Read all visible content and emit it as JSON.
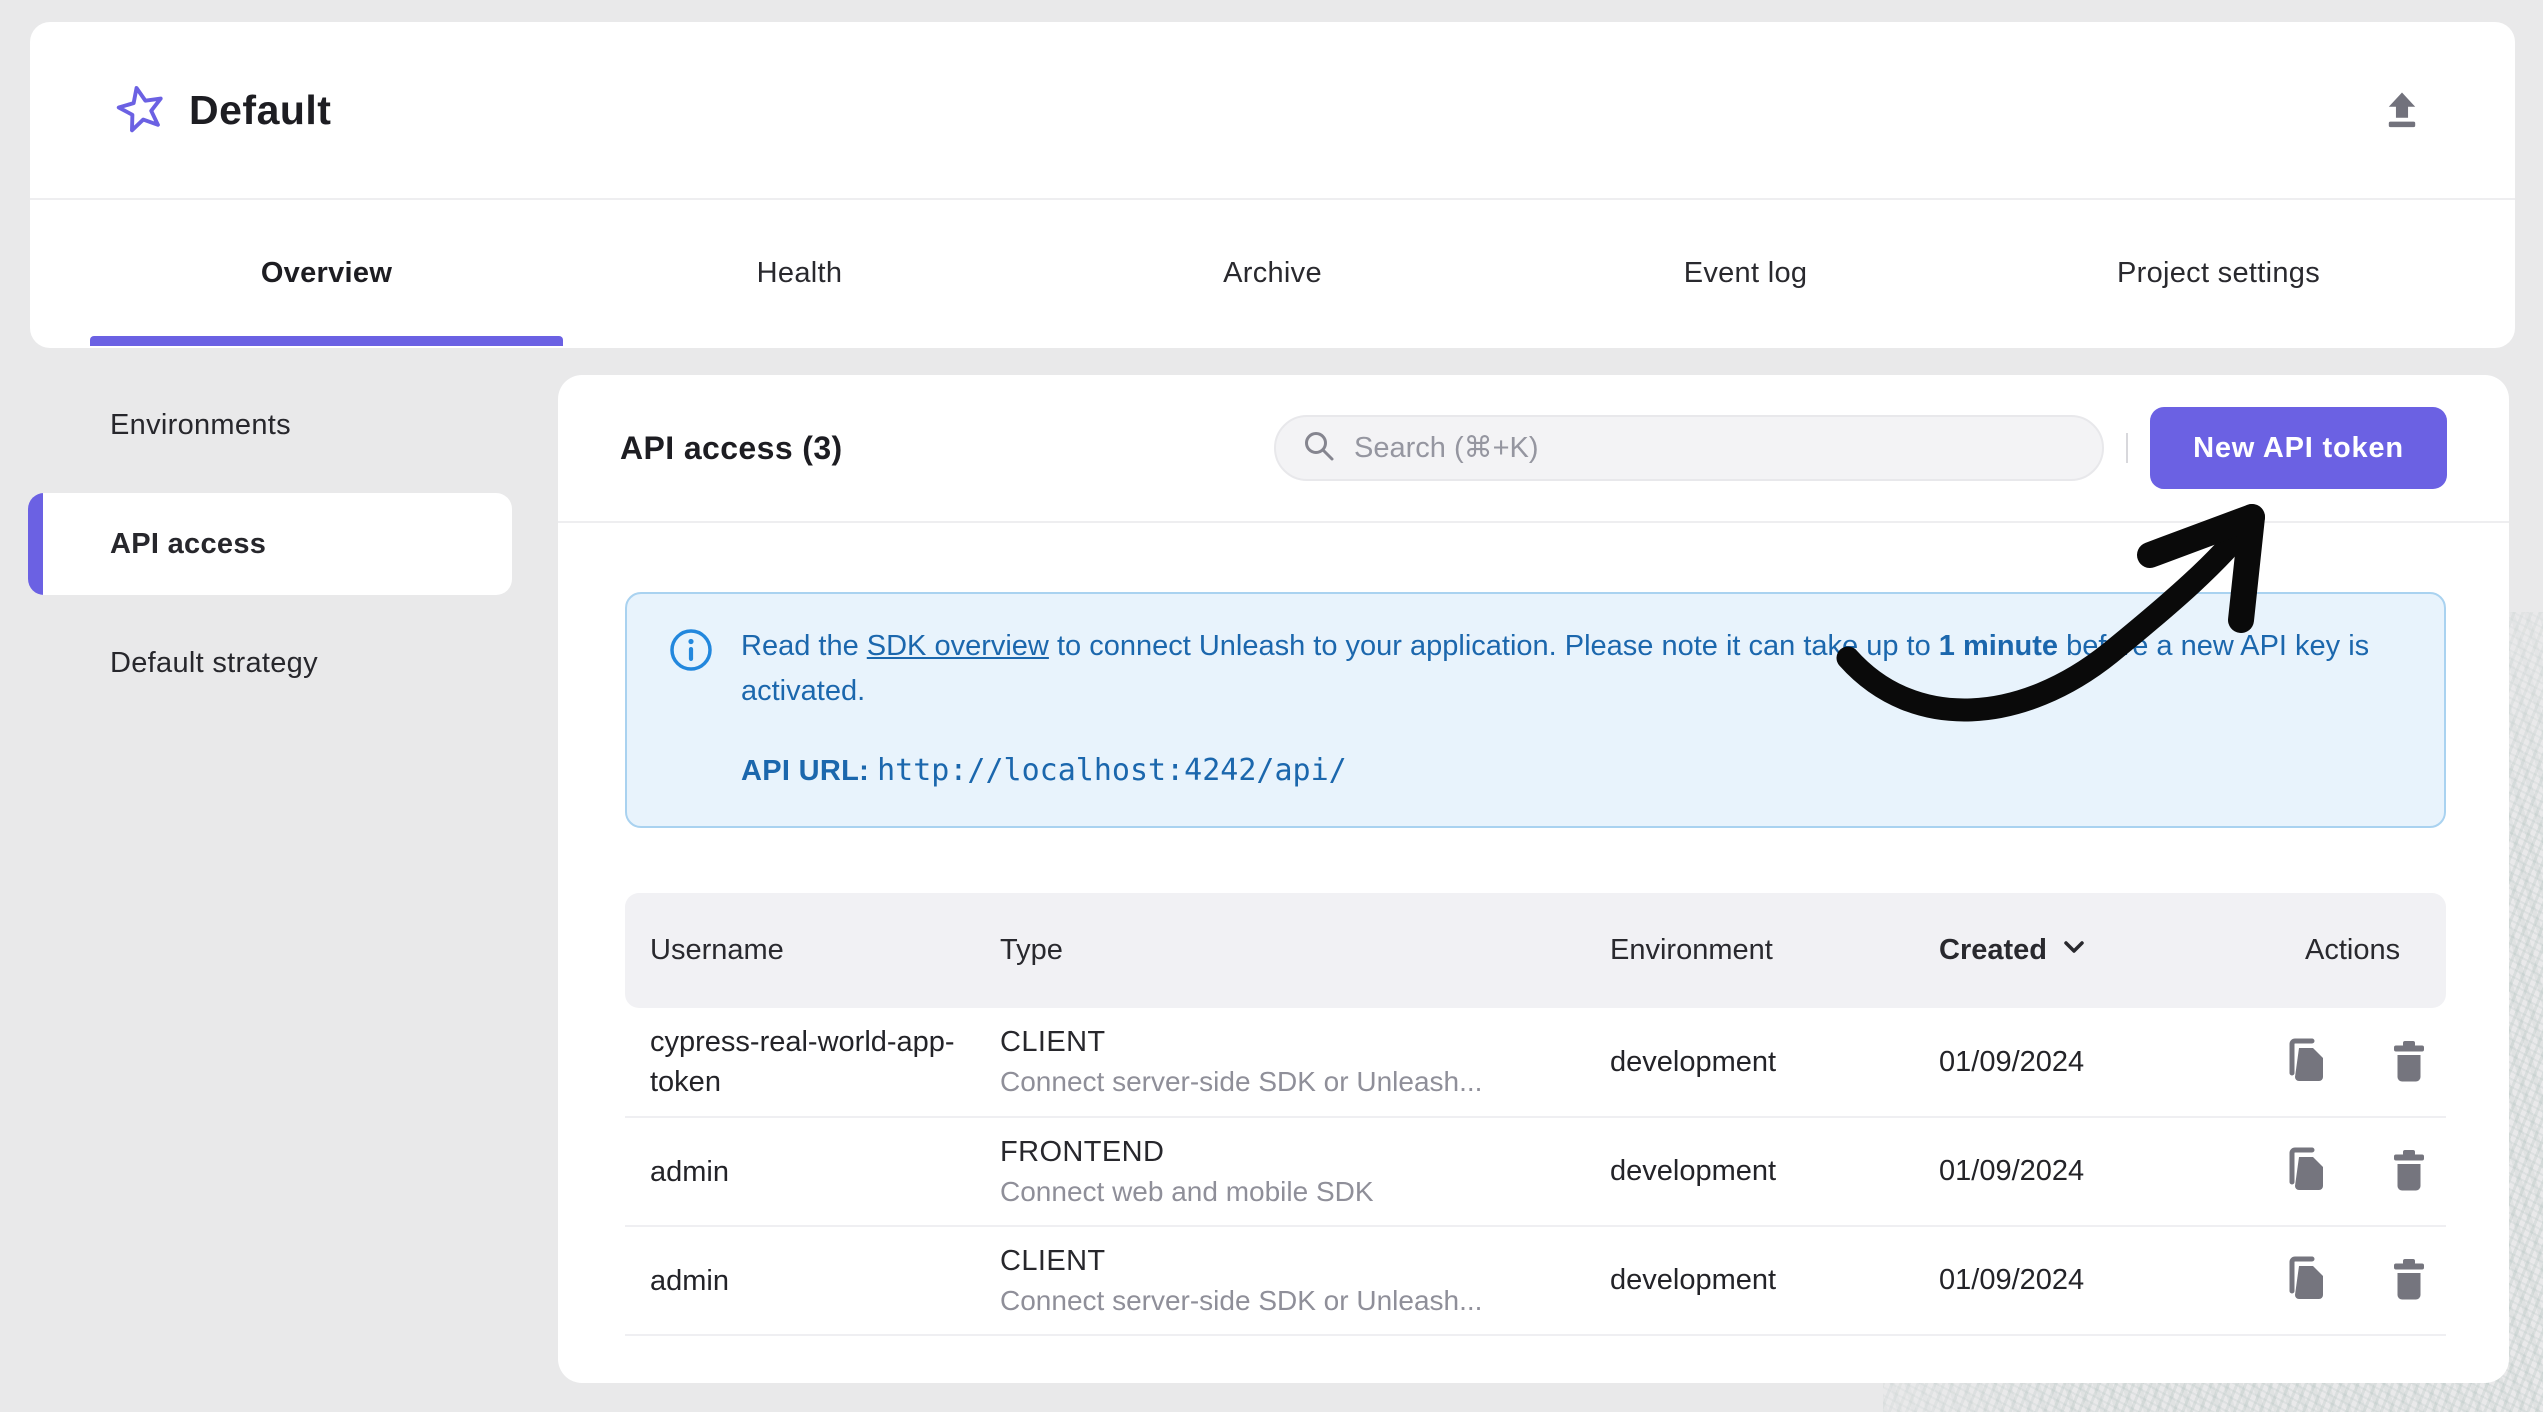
{
  "project_header": {
    "title": "Default",
    "star_icon": "star-icon",
    "upload_icon": "upload-icon"
  },
  "tabs": [
    {
      "label": "Overview",
      "active": true
    },
    {
      "label": "Health",
      "active": false
    },
    {
      "label": "Archive",
      "active": false
    },
    {
      "label": "Event log",
      "active": false
    },
    {
      "label": "Project settings",
      "active": false
    }
  ],
  "sidebar": {
    "items": [
      {
        "label": "Environments",
        "active": false
      },
      {
        "label": "API access",
        "active": true
      },
      {
        "label": "Default strategy",
        "active": false
      }
    ]
  },
  "main": {
    "title": "API access (3)",
    "search": {
      "placeholder": "Search (⌘+K)",
      "icon": "search-icon",
      "value": ""
    },
    "new_token_button": "New API token",
    "alert": {
      "icon": "info-icon",
      "text_1": "Read the ",
      "link": "SDK overview",
      "text_2": " to connect Unleash to your application. Please note it can take up to ",
      "bold": "1 minute",
      "text_3": " before a new API key is activated.",
      "api_url_label": "API URL:",
      "api_url": "http://localhost:4242/api/"
    },
    "table": {
      "columns": [
        "Username",
        "Type",
        "Environment",
        "Created",
        "Actions"
      ],
      "sorted_column": "Created",
      "sort_icon": "chevron-down-icon",
      "row_action_icons": [
        "copy-icon",
        "delete-icon"
      ],
      "rows": [
        {
          "username": "cypress-real-world-app-token",
          "type": "CLIENT",
          "type_description": "Connect server-side SDK or Unleash...",
          "environment": "development",
          "created": "01/09/2024"
        },
        {
          "username": "admin",
          "type": "FRONTEND",
          "type_description": "Connect web and mobile SDK",
          "environment": "development",
          "created": "01/09/2024"
        },
        {
          "username": "admin",
          "type": "CLIENT",
          "type_description": "Connect server-side SDK or Unleash...",
          "environment": "development",
          "created": "01/09/2024"
        }
      ]
    }
  },
  "colors": {
    "primary": "#6b61e3",
    "page_bg": "#e9e9ea",
    "alert_bg": "#e8f3fc",
    "alert_border": "#a9d2f0",
    "alert_text": "#1b67ad",
    "info_icon_blue": "#2287dd",
    "icon_gray": "#75757e",
    "table_header_bg": "#f1f1f4",
    "annotation_arrow": "#0a0a0a"
  }
}
